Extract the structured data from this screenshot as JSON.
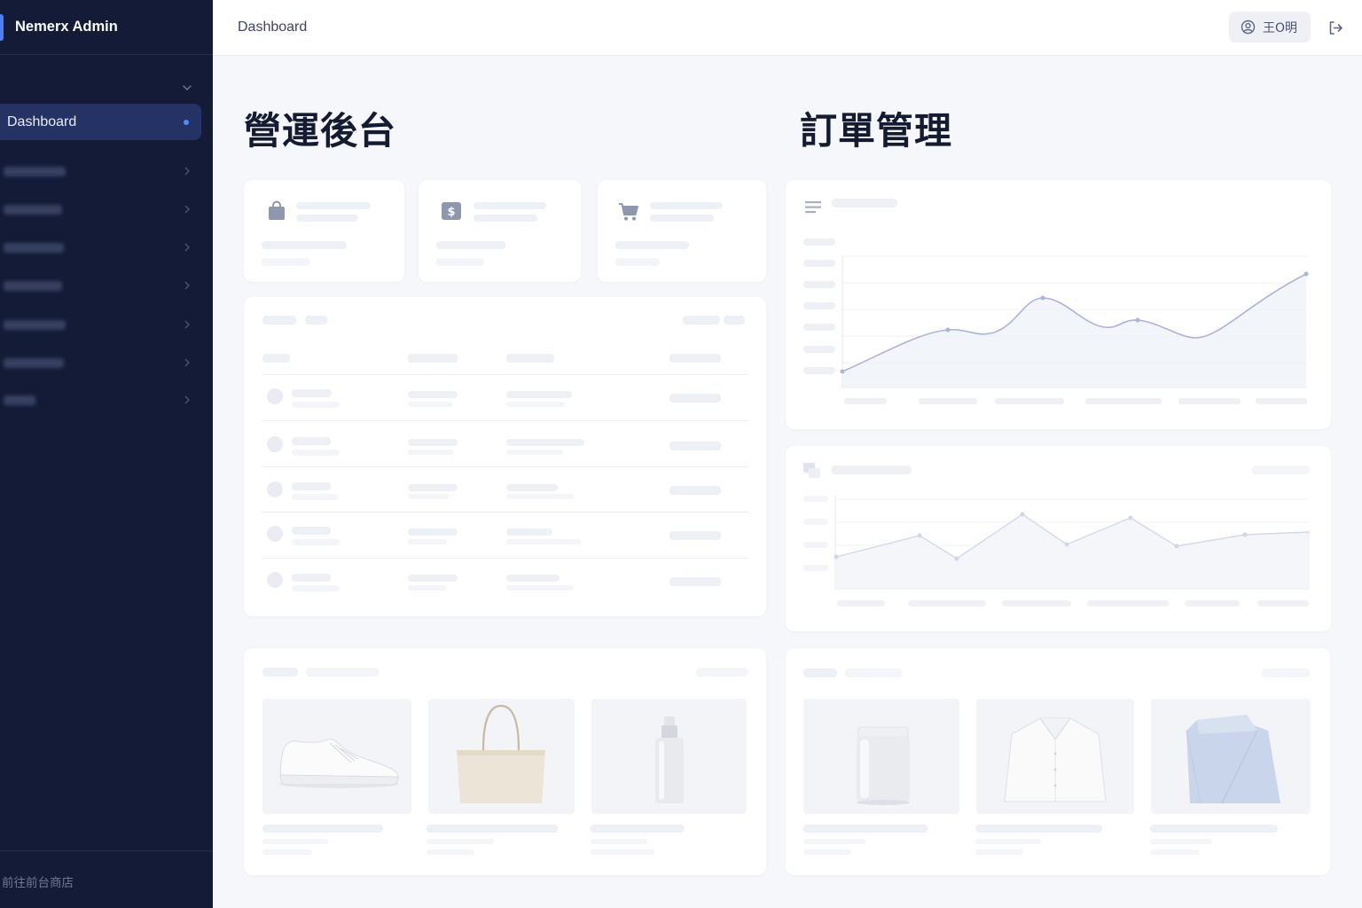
{
  "app": {
    "brand": "Nemerx Admin"
  },
  "header": {
    "title": "Dashboard",
    "user_name": "王O明"
  },
  "sidebar": {
    "active_item": "Dashboard",
    "footer_link": "前往前台商店"
  },
  "main": {
    "title_left": "營運後台",
    "title_right": "訂單管理"
  },
  "stats": [
    {
      "icon": "shopping-bag-icon"
    },
    {
      "icon": "dollar-icon",
      "glyph": "$"
    },
    {
      "icon": "cart-icon"
    }
  ],
  "colors": {
    "sidebar_bg": "#131b36",
    "accent": "#4f8cff",
    "chart_line": "#aab4d8"
  },
  "products_left": [
    {
      "icon": "sneaker-icon"
    },
    {
      "icon": "tote-bag-icon"
    },
    {
      "icon": "spray-bottle-icon"
    }
  ],
  "products_right": [
    {
      "icon": "jar-icon"
    },
    {
      "icon": "shirt-icon"
    },
    {
      "icon": "folded-shirt-icon"
    }
  ]
}
